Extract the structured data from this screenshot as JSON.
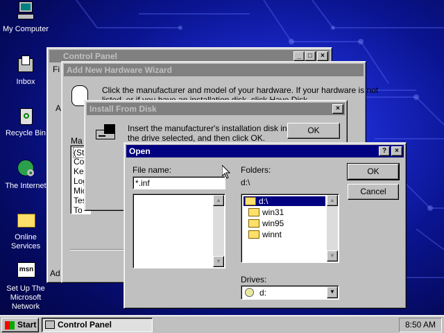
{
  "desktop": {
    "icons": [
      {
        "label": "My Computer",
        "icon": "computer-icon"
      },
      {
        "label": "Inbox",
        "icon": "inbox-icon"
      },
      {
        "label": "Recycle Bin",
        "icon": "recycle-bin-icon"
      },
      {
        "label": "The Internet",
        "icon": "internet-globe-icon"
      },
      {
        "label": "Online Services",
        "icon": "folder-icon"
      },
      {
        "label": "Set Up The Microsoft Network",
        "icon": "msn-icon"
      }
    ]
  },
  "control_panel": {
    "title": "Control Panel",
    "menu_first": "File",
    "visible_letter": "A",
    "adder_label": "Ad"
  },
  "wizard": {
    "title": "Add New Hardware Wizard",
    "instruction_line1": "Click the manufacturer and model of your hardware. If your hardware is not",
    "instruction_line2": "listed, or if you have an installation disk, click Have Disk.",
    "manuf_label": "Ma",
    "list_items": [
      "(St",
      "Cor",
      "Ker",
      "Log",
      "Mic",
      "Tes",
      "To"
    ]
  },
  "install_from_disk": {
    "title": "Install From Disk",
    "message_line1": "Insert the manufacturer's installation disk into",
    "message_line2": "the drive selected, and then click OK.",
    "ok_label": "OK"
  },
  "open_dialog": {
    "title": "Open",
    "file_name_label": "File name:",
    "file_name_value": "*.inf",
    "folders_label": "Folders:",
    "current_path": "d:\\",
    "folders": [
      "d:\\",
      "win31",
      "win95",
      "winnt"
    ],
    "drives_label": "Drives:",
    "drive_value": "d:",
    "ok_label": "OK",
    "cancel_label": "Cancel",
    "help_glyph": "?",
    "close_glyph": "×"
  },
  "taskbar": {
    "start_label": "Start",
    "task_label": "Control Panel",
    "clock": "8:50 AM"
  },
  "colors": {
    "active_title": "#000080",
    "inactive_title": "#808080",
    "face": "#c0c0c0",
    "selection": "#000080"
  }
}
